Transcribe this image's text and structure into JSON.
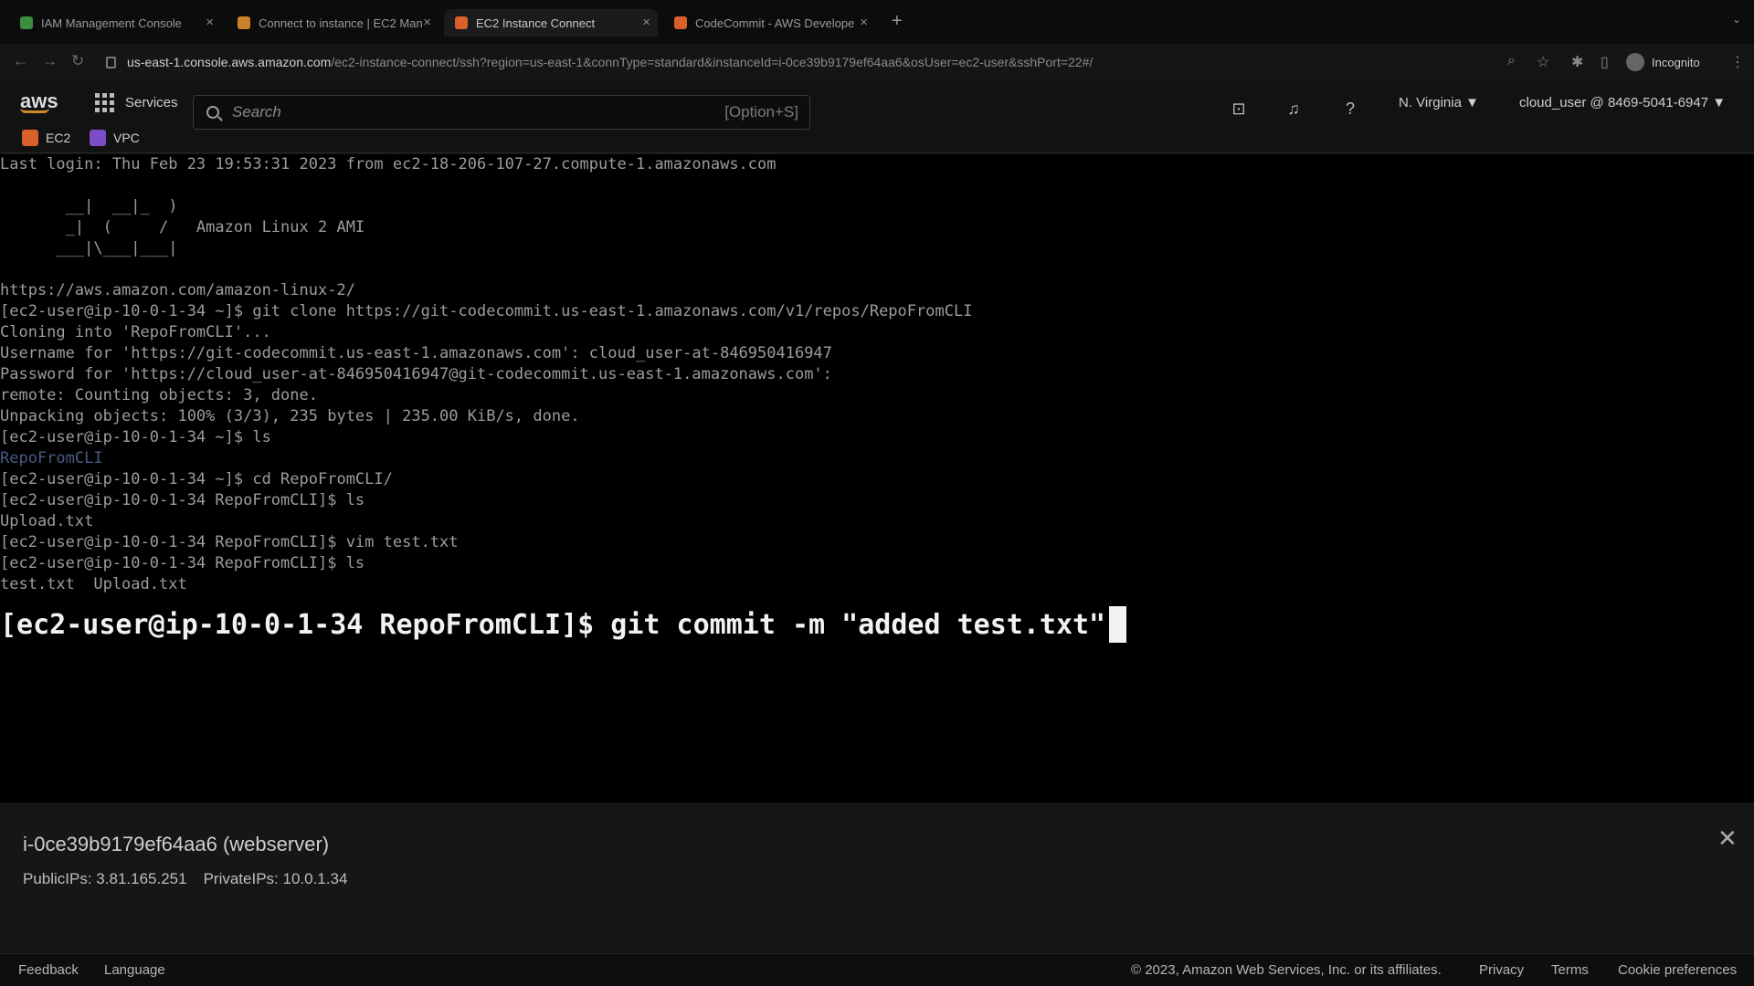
{
  "browser": {
    "tabs": [
      {
        "label": "IAM Management Console",
        "favicon_color": "#3d8c40"
      },
      {
        "label": "Connect to instance | EC2 Man",
        "favicon_color": "#c9822a"
      },
      {
        "label": "EC2 Instance Connect",
        "favicon_color": "#d8602a"
      },
      {
        "label": "CodeCommit - AWS Develope",
        "favicon_color": "#d8602a"
      }
    ],
    "url_host": "us-east-1.console.aws.amazon.com",
    "url_path": "/ec2-instance-connect/ssh?region=us-east-1&connType=standard&instanceId=i-0ce39b9179ef64aa6&osUser=ec2-user&sshPort=22#/",
    "incognito_label": "Incognito"
  },
  "aws_header": {
    "logo": "aws",
    "services_label": "Services",
    "search_placeholder": "Search",
    "search_shortcut": "[Option+S]",
    "region": "N. Virginia",
    "account": "cloud_user @ 8469-5041-6947",
    "favorites": [
      {
        "label": "EC2",
        "color": "#d8602a"
      },
      {
        "label": "VPC",
        "color": "#7b4dc9"
      }
    ]
  },
  "terminal": {
    "lines": [
      "Last login: Thu Feb 23 19:53:31 2023 from ec2-18-206-107-27.compute-1.amazonaws.com",
      "",
      "       __|  __|_  )",
      "       _|  (     /   Amazon Linux 2 AMI",
      "      ___|\\___|___|",
      "",
      "https://aws.amazon.com/amazon-linux-2/",
      "[ec2-user@ip-10-0-1-34 ~]$ git clone https://git-codecommit.us-east-1.amazonaws.com/v1/repos/RepoFromCLI",
      "Cloning into 'RepoFromCLI'...",
      "Username for 'https://git-codecommit.us-east-1.amazonaws.com': cloud_user-at-846950416947",
      "Password for 'https://cloud_user-at-846950416947@git-codecommit.us-east-1.amazonaws.com':",
      "remote: Counting objects: 3, done.",
      "Unpacking objects: 100% (3/3), 235 bytes | 235.00 KiB/s, done.",
      "[ec2-user@ip-10-0-1-34 ~]$ ls",
      "RepoFromCLI",
      "[ec2-user@ip-10-0-1-34 ~]$ cd RepoFromCLI/",
      "[ec2-user@ip-10-0-1-34 RepoFromCLI]$ ls",
      "Upload.txt",
      "[ec2-user@ip-10-0-1-34 RepoFromCLI]$ vim test.txt",
      "[ec2-user@ip-10-0-1-34 RepoFromCLI]$ ls",
      "test.txt  Upload.txt"
    ],
    "current_command": "[ec2-user@ip-10-0-1-34 RepoFromCLI]$ git commit -m \"added test.txt\""
  },
  "instance_panel": {
    "name": "i-0ce39b9179ef64aa6 (webserver)",
    "public_ips": "PublicIPs: 3.81.165.251",
    "private_ips": "PrivateIPs: 10.0.1.34"
  },
  "footer": {
    "feedback": "Feedback",
    "language": "Language",
    "copyright": "© 2023, Amazon Web Services, Inc. or its affiliates.",
    "privacy": "Privacy",
    "terms": "Terms",
    "cookies": "Cookie preferences"
  }
}
